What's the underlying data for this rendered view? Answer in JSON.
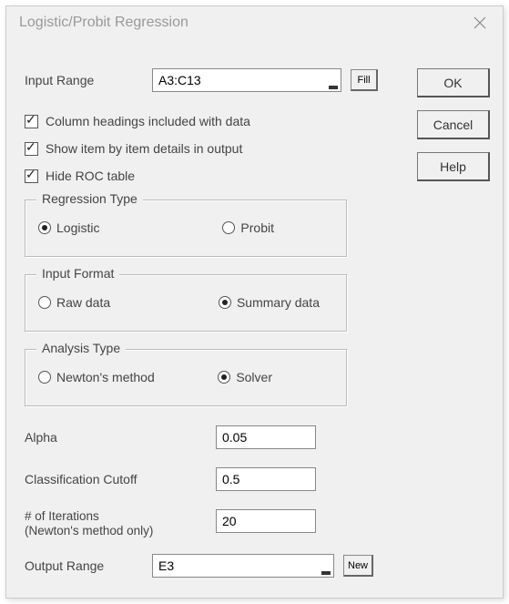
{
  "title": "Logistic/Probit Regression",
  "inputRange": {
    "label": "Input Range",
    "value": "A3:C13",
    "fillBtn": "Fill"
  },
  "buttons": {
    "ok": "OK",
    "cancel": "Cancel",
    "help": "Help"
  },
  "checks": {
    "headings": "Column headings included with data",
    "details": "Show item by item details in output",
    "hideRoc": "Hide ROC table"
  },
  "groups": {
    "regType": {
      "legend": "Regression Type",
      "opt1": "Logistic",
      "opt2": "Probit"
    },
    "inFmt": {
      "legend": "Input Format",
      "opt1": "Raw data",
      "opt2": "Summary data"
    },
    "anType": {
      "legend": "Analysis Type",
      "opt1": "Newton's method",
      "opt2": "Solver"
    }
  },
  "params": {
    "alpha": {
      "label": "Alpha",
      "value": "0.05"
    },
    "cutoff": {
      "label": "Classification Cutoff",
      "value": "0.5"
    },
    "iters": {
      "label1": "# of Iterations",
      "label2": "(Newton's method only)",
      "value": "20"
    }
  },
  "outputRange": {
    "label": "Output Range",
    "value": "E3",
    "newBtn": "New"
  }
}
